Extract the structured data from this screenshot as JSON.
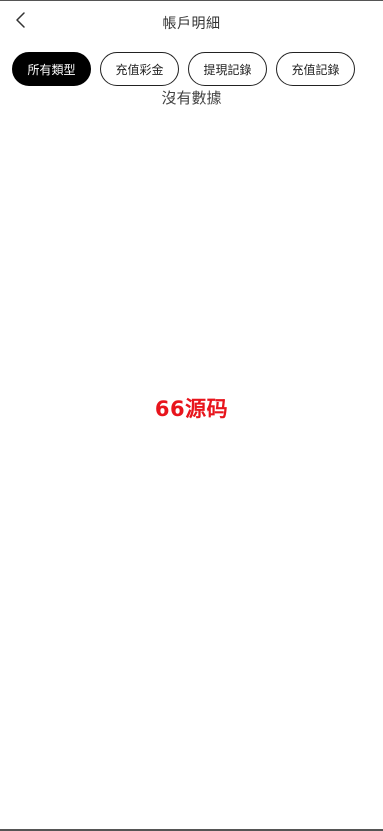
{
  "header": {
    "back_icon": "chevron-left-icon",
    "title": "帳戶明細"
  },
  "tabs": [
    {
      "label": "所有類型",
      "active": true
    },
    {
      "label": "充值彩金",
      "active": false
    },
    {
      "label": "提現記錄",
      "active": false
    },
    {
      "label": "充值記錄",
      "active": false
    }
  ],
  "empty_state": {
    "message": "沒有數據"
  },
  "watermark": {
    "text": "66源码",
    "color": "#e8141c"
  },
  "colors": {
    "active_tab_bg": "#000000",
    "active_tab_text": "#ffffff",
    "tab_border": "#222222"
  }
}
